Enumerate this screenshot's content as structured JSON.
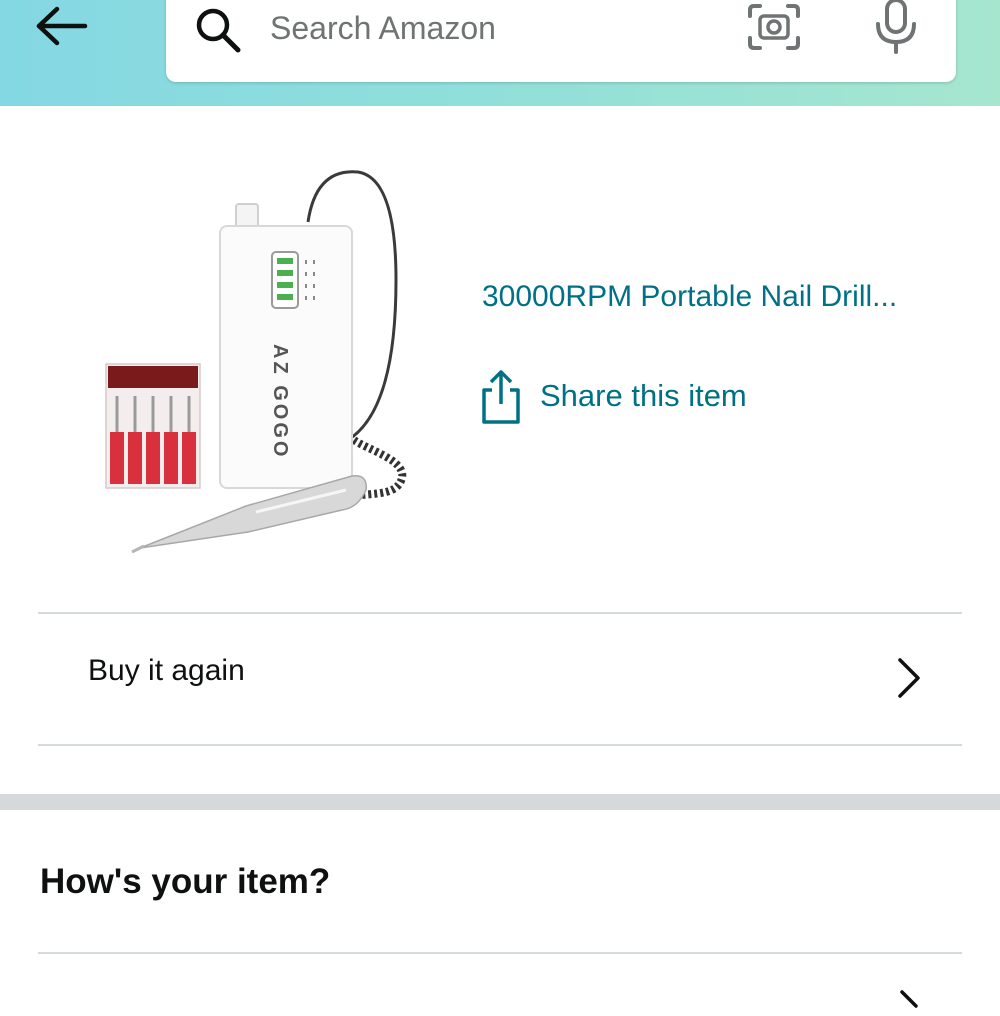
{
  "header": {
    "back_icon": "arrow-left-icon",
    "search": {
      "placeholder": "Search Amazon",
      "value": "",
      "search_icon": "search-icon",
      "camera_icon": "camera-lens-icon",
      "mic_icon": "microphone-icon"
    }
  },
  "product": {
    "title": "30000RPM Portable Nail Drill...",
    "brand_on_device": "AZ GOGO",
    "share_label": "Share this item",
    "share_icon": "share-icon"
  },
  "actions": {
    "buy_again_label": "Buy it again",
    "chevron_icon": "chevron-right-icon"
  },
  "review_section": {
    "title": "How's your item?"
  },
  "colors": {
    "header_gradient_start": "#84d8e3",
    "header_gradient_end": "#a6e6cf",
    "link": "#007185",
    "text": "#0f1111",
    "divider": "#d5dbdb",
    "section_band": "#d5d9d9"
  }
}
